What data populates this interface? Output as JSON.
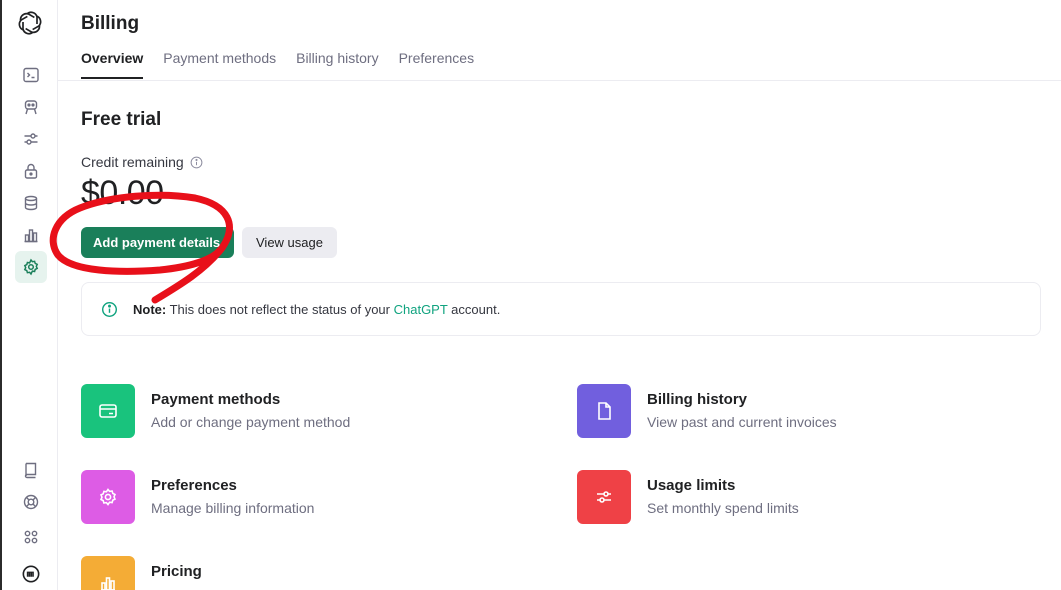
{
  "header": {
    "title": "Billing",
    "tabs": [
      "Overview",
      "Payment methods",
      "Billing history",
      "Preferences"
    ]
  },
  "overview": {
    "plan_title": "Free trial",
    "credit_label": "Credit remaining",
    "credit_amount": "$0.00",
    "primary_button": "Add payment details",
    "secondary_button": "View usage"
  },
  "note": {
    "prefix": "Note:",
    "text_before": " This does not reflect the status of your ",
    "link": "ChatGPT",
    "text_after": " account."
  },
  "cards": [
    {
      "title": "Payment methods",
      "desc": "Add or change payment method",
      "color": "#19c37d"
    },
    {
      "title": "Billing history",
      "desc": "View past and current invoices",
      "color": "#715fde"
    },
    {
      "title": "Preferences",
      "desc": "Manage billing information",
      "color": "#dd5ce5"
    },
    {
      "title": "Usage limits",
      "desc": "Set monthly spend limits",
      "color": "#ef4146"
    },
    {
      "title": "Pricing",
      "desc": "",
      "color": "#f4ac36"
    }
  ],
  "colors": {
    "accent": "#1a7f5a",
    "annotation": "#e8101a"
  },
  "sidebar": {
    "icons": [
      "openai-logo-icon",
      "terminal-icon",
      "assistant-icon",
      "sliders-icon",
      "lock-icon",
      "database-icon",
      "bar-chart-icon",
      "gear-icon",
      "book-icon",
      "help-icon",
      "apps-icon",
      "org-avatar-icon"
    ]
  }
}
